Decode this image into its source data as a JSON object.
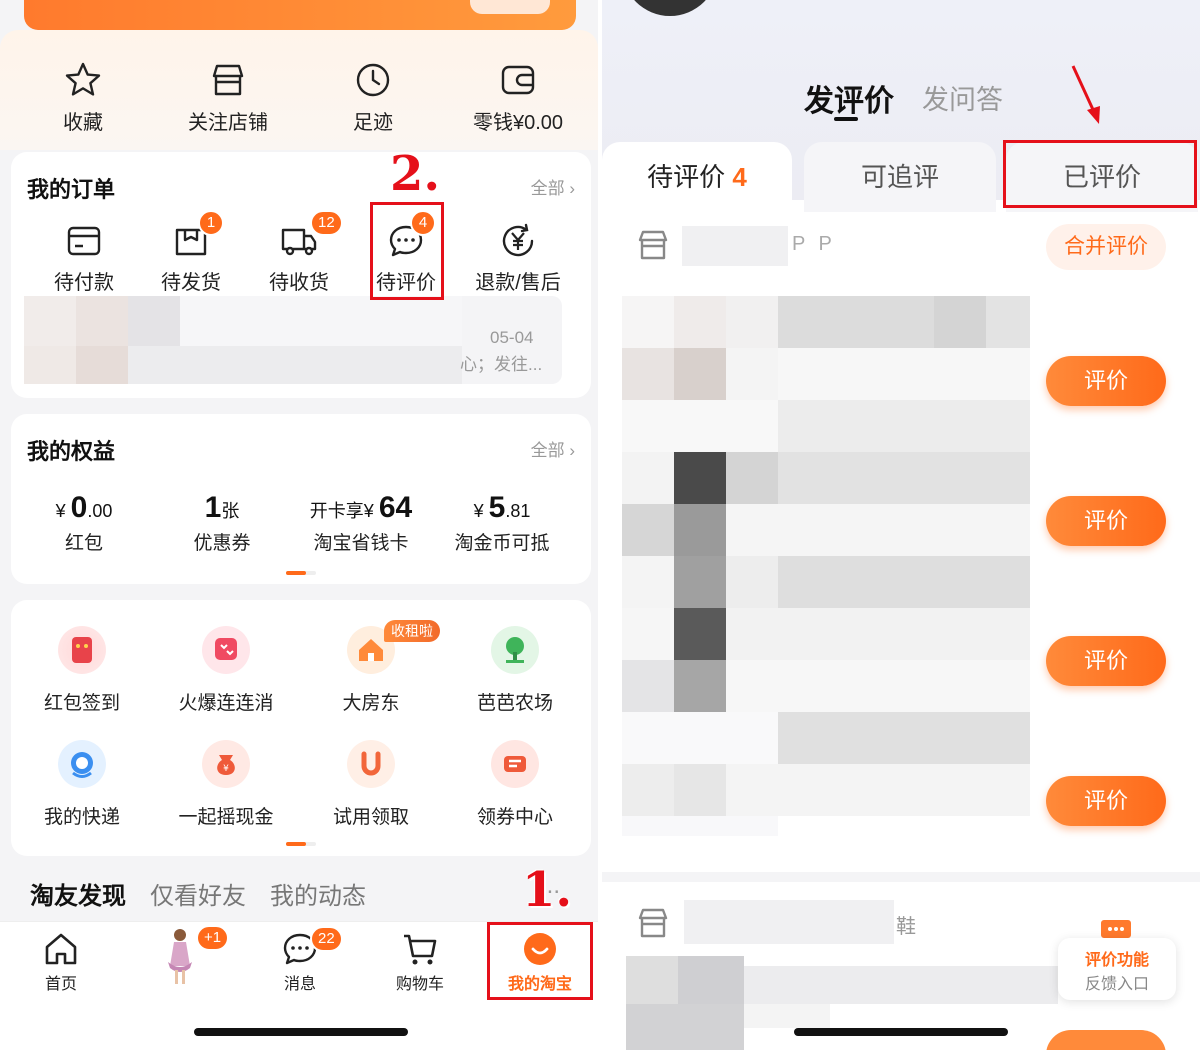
{
  "left": {
    "quick": [
      {
        "label": "收藏",
        "icon": "star-icon"
      },
      {
        "label": "关注店铺",
        "icon": "store-icon"
      },
      {
        "label": "足迹",
        "icon": "clock-icon"
      },
      {
        "label": "零钱¥0.00",
        "icon": "wallet-icon"
      }
    ],
    "orders": {
      "title": "我的订单",
      "more": "全部",
      "items": [
        {
          "label": "待付款",
          "icon": "card-icon",
          "badge": ""
        },
        {
          "label": "待发货",
          "icon": "box-icon",
          "badge": "1"
        },
        {
          "label": "待收货",
          "icon": "truck-icon",
          "badge": "12"
        },
        {
          "label": "待评价",
          "icon": "comment-icon",
          "badge": "4"
        },
        {
          "label": "退款/售后",
          "icon": "yuan-refund-icon",
          "badge": ""
        }
      ],
      "latest_date": "05-04",
      "latest_status": "心；发往..."
    },
    "equity": {
      "title": "我的权益",
      "more": "全部",
      "items": [
        {
          "prefix": "¥",
          "big": "0",
          "small": ".00",
          "label": "红包"
        },
        {
          "prefix": "",
          "big": "1",
          "small": "张",
          "label": "优惠券"
        },
        {
          "prefix": "开卡享¥",
          "big": "64",
          "small": "",
          "label": "淘宝省钱卡"
        },
        {
          "prefix": "¥",
          "big": "5",
          "small": ".81",
          "label": "淘金币可抵"
        }
      ]
    },
    "apps": [
      {
        "label": "红包签到",
        "icon": "red-envelope-icon"
      },
      {
        "label": "火爆连连消",
        "icon": "hearts-game-icon"
      },
      {
        "label": "大房东",
        "icon": "house-icon",
        "tag": "收租啦"
      },
      {
        "label": "芭芭农场",
        "icon": "tree-icon"
      },
      {
        "label": "我的快递",
        "icon": "courier-icon"
      },
      {
        "label": "一起摇现金",
        "icon": "money-bag-icon"
      },
      {
        "label": "试用领取",
        "icon": "u-trial-icon"
      },
      {
        "label": "领券中心",
        "icon": "coupon-icon"
      }
    ],
    "feed_tabs": [
      "淘友发现",
      "仅看好友",
      "我的动态"
    ],
    "feed_more": "...",
    "tabbar": [
      {
        "label": "首页",
        "icon": "home-icon",
        "badge": ""
      },
      {
        "label": "",
        "icon": "avatar-doll-icon",
        "badge": "+1"
      },
      {
        "label": "消息",
        "icon": "message-icon",
        "badge": "22"
      },
      {
        "label": "购物车",
        "icon": "cart-icon",
        "badge": ""
      },
      {
        "label": "我的淘宝",
        "icon": "my-taobao-icon",
        "badge": ""
      }
    ],
    "steps": {
      "one": "1.",
      "two": "2."
    }
  },
  "right": {
    "segments": [
      "发评价",
      "发问答"
    ],
    "tabs": [
      {
        "label": "待评价",
        "count": "4"
      },
      {
        "label": "可追评",
        "count": ""
      },
      {
        "label": "已评价",
        "count": ""
      }
    ],
    "store1_suffix": "P P",
    "merge_button": "合并评价",
    "eval_button": "评价",
    "store2_suffix": "鞋",
    "feedback_line1": "评价功能",
    "feedback_line2": "反馈入口"
  },
  "colors": {
    "accent": "#ff6a1a",
    "highlight_box": "#e5101a"
  }
}
